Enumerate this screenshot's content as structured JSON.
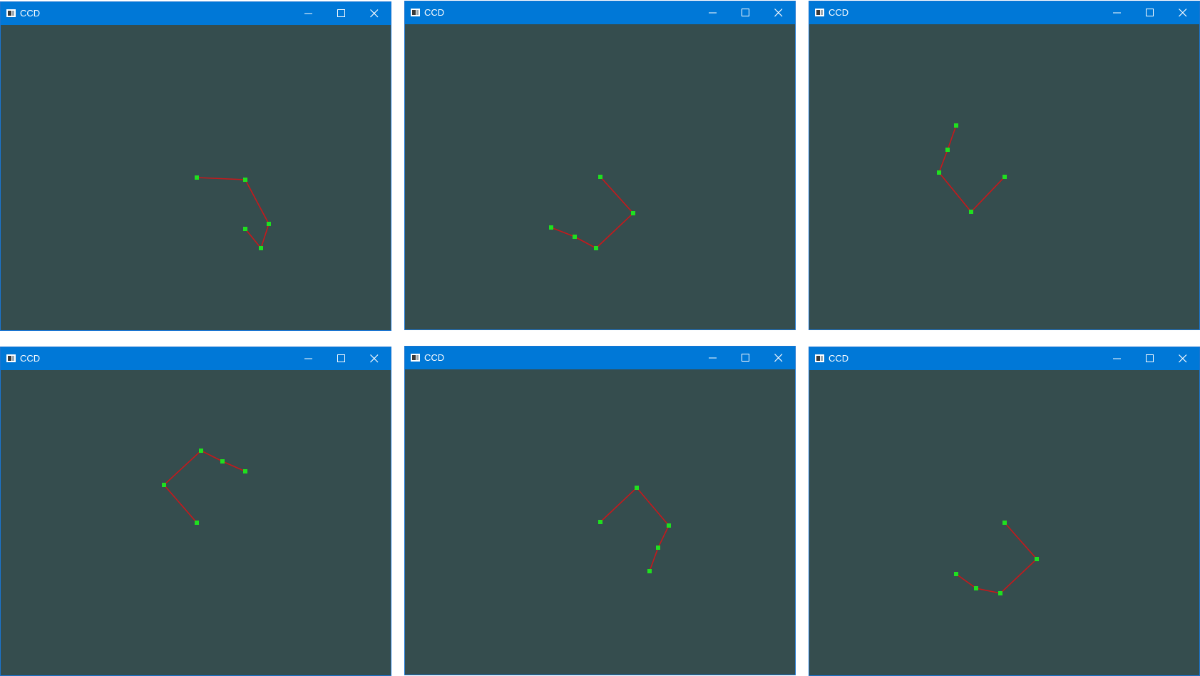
{
  "colors": {
    "titlebar": "#0078d7",
    "canvas_background": "#354d4e",
    "link_line": "#c8181b",
    "joint_point": "#1fe01f"
  },
  "icons": {
    "app": "app-window-icon",
    "minimize": "minimize-icon",
    "maximize": "maximize-icon",
    "close": "close-icon"
  },
  "windows": [
    {
      "title": "CCD"
    },
    {
      "title": "CCD"
    },
    {
      "title": "CCD"
    },
    {
      "title": "CCD"
    },
    {
      "title": "CCD"
    },
    {
      "title": "CCD"
    }
  ]
}
